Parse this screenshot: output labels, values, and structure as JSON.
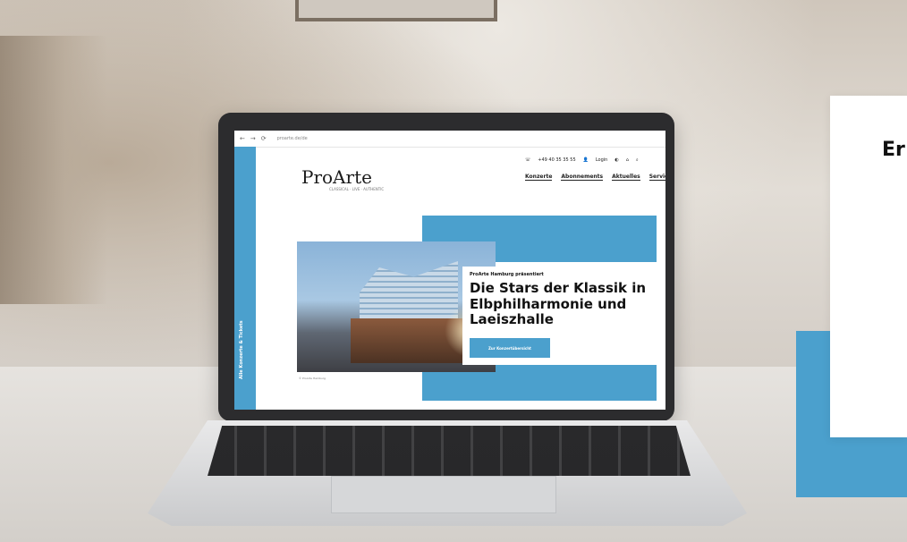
{
  "browser": {
    "url": "proarte.de/de",
    "nav_back": "←",
    "nav_forward": "→",
    "reload": "⟳"
  },
  "site": {
    "logo": "ProArte",
    "tagline": "CLASSICAL · LIVE · AUTHENTIC",
    "phone": "+49 40 35 35 55",
    "login": "Login",
    "tab_rail": "Alle Konzerte & Tickets",
    "nav": [
      "Konzerte",
      "Abonnements",
      "Aktuelles",
      "Service"
    ]
  },
  "hero": {
    "kicker": "ProArte Hamburg präsentiert",
    "headline": "Die Stars der Klassik in Elbphilharmonie und Laeiszhalle",
    "cta": "Zur Konzertübersicht",
    "image_caption": "© ProArte Hamburg"
  },
  "overlay": {
    "text": "Er"
  },
  "colors": {
    "brand_blue": "#4ba0cd",
    "text_dark": "#111111"
  },
  "icons": [
    "phone-icon",
    "user-icon",
    "contrast-icon",
    "cart-icon",
    "search-icon"
  ]
}
